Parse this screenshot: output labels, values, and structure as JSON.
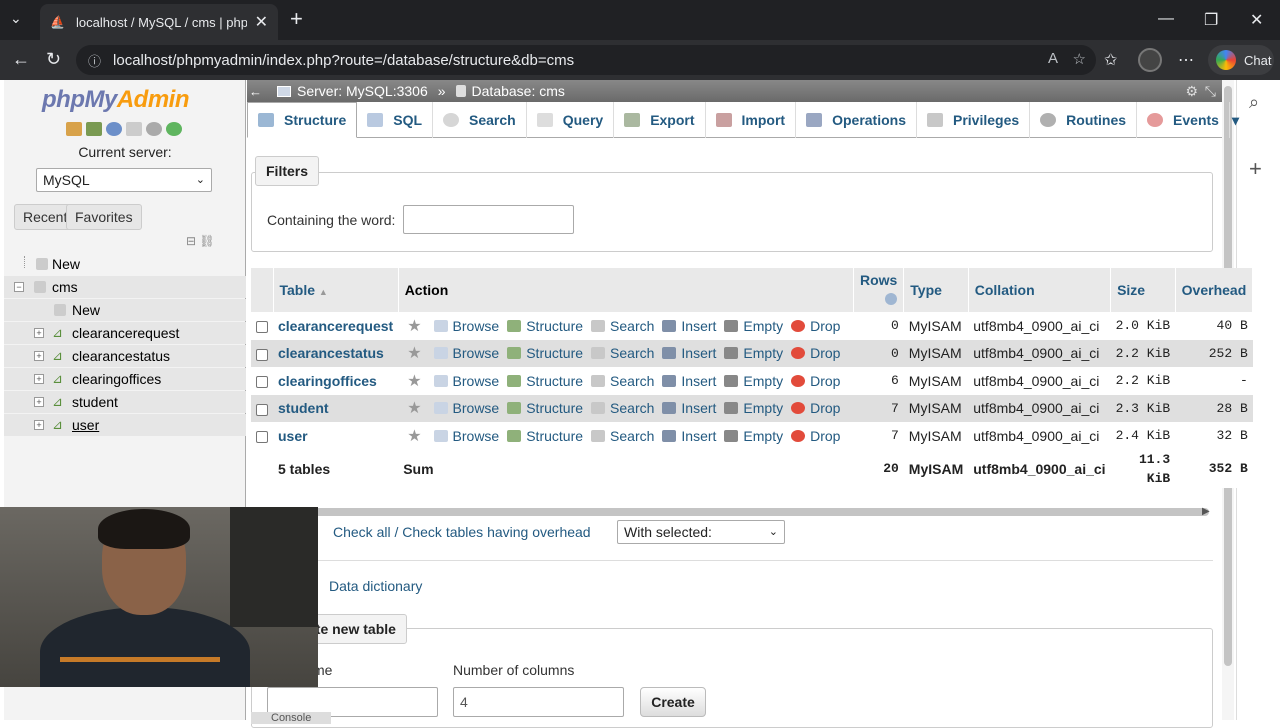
{
  "browser": {
    "tab_title": "localhost / MySQL / cms | phpMyA",
    "url": "localhost/phpmyadmin/index.php?route=/database/structure&db=cms",
    "chat_label": "Chat"
  },
  "sidebar": {
    "logo_php": "php",
    "logo_my": "My",
    "logo_admin": "Admin",
    "current_server_label": "Current server:",
    "server_selected": "MySQL",
    "recent_label": "Recent",
    "favorites_label": "Favorites",
    "tree": {
      "new_root": "New",
      "db": "cms",
      "new_db": "New",
      "tables": [
        "clearancerequest",
        "clearancestatus",
        "clearingoffices",
        "student",
        "user"
      ]
    }
  },
  "breadcrumb": {
    "server": "Server: MySQL:3306",
    "separator": "»",
    "database": "Database: cms"
  },
  "tabs": [
    "Structure",
    "SQL",
    "Search",
    "Query",
    "Export",
    "Import",
    "Operations",
    "Privileges",
    "Routines",
    "Events"
  ],
  "filters": {
    "legend": "Filters",
    "label": "Containing the word:",
    "value": ""
  },
  "table_list": {
    "headers": {
      "table": "Table",
      "sort_indicator": "▲",
      "action": "Action",
      "rows": "Rows",
      "type": "Type",
      "collation": "Collation",
      "size": "Size",
      "overhead": "Overhead"
    },
    "actions": [
      "Browse",
      "Structure",
      "Search",
      "Insert",
      "Empty",
      "Drop"
    ],
    "rows": [
      {
        "name": "clearancerequest",
        "rows": "0",
        "type": "MyISAM",
        "collation": "utf8mb4_0900_ai_ci",
        "size": "2.0 KiB",
        "overhead": "40 B"
      },
      {
        "name": "clearancestatus",
        "rows": "0",
        "type": "MyISAM",
        "collation": "utf8mb4_0900_ai_ci",
        "size": "2.2 KiB",
        "overhead": "252 B"
      },
      {
        "name": "clearingoffices",
        "rows": "6",
        "type": "MyISAM",
        "collation": "utf8mb4_0900_ai_ci",
        "size": "2.2 KiB",
        "overhead": "-"
      },
      {
        "name": "student",
        "rows": "7",
        "type": "MyISAM",
        "collation": "utf8mb4_0900_ai_ci",
        "size": "2.3 KiB",
        "overhead": "28 B"
      },
      {
        "name": "user",
        "rows": "7",
        "type": "MyISAM",
        "collation": "utf8mb4_0900_ai_ci",
        "size": "2.4 KiB",
        "overhead": "32 B"
      }
    ],
    "summary": {
      "count": "5 tables",
      "label": "Sum",
      "rows": "20",
      "type": "MyISAM",
      "collation": "utf8mb4_0900_ai_ci",
      "size_value": "11.3",
      "size_unit": "KiB",
      "overhead": "352 B"
    }
  },
  "bulk": {
    "check_all": "Check all / Check tables having overhead",
    "with_selected": "With selected:"
  },
  "data_dictionary": "Data dictionary",
  "create_table": {
    "legend": "ate new table",
    "name_label": "me",
    "columns_label": "Number of columns",
    "columns_value": "4",
    "create_button": "Create"
  },
  "console_label": "Console",
  "colors": {
    "link": "#235a81",
    "accent_orange": "#f89c0e",
    "logo_blue": "#6c78af"
  }
}
